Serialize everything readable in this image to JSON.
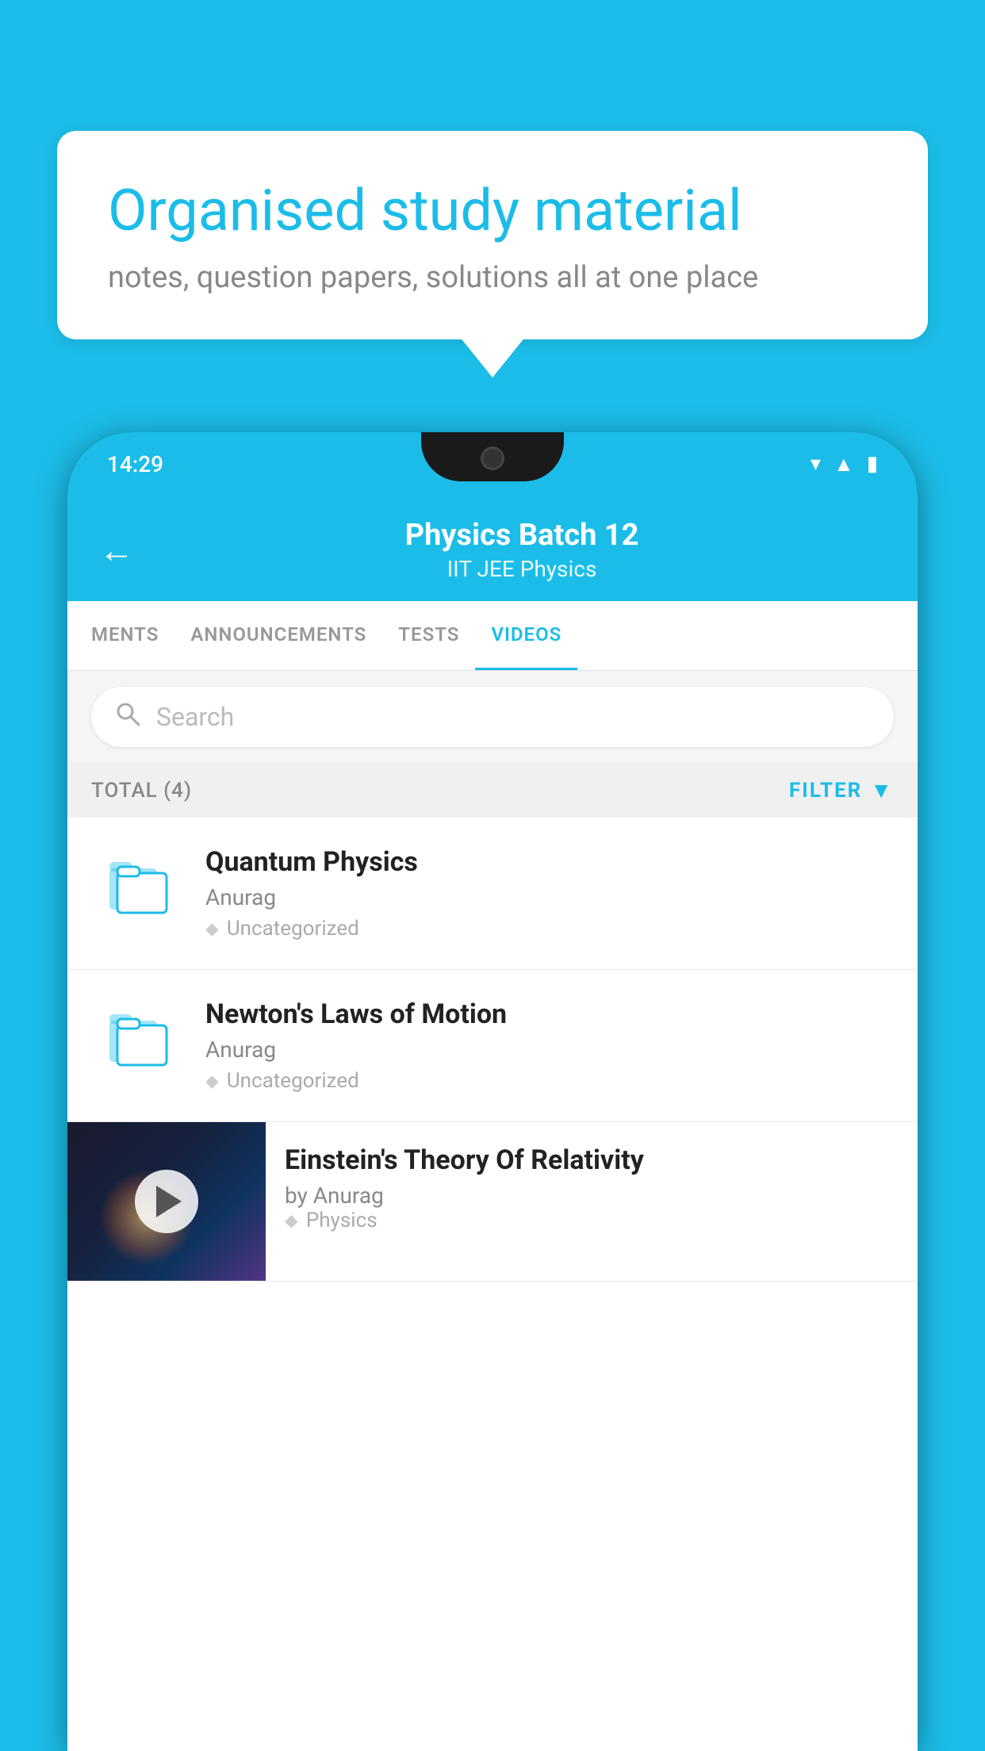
{
  "background_color": "#1BBDE8",
  "speech_bubble": {
    "title": "Organised study material",
    "subtitle": "notes, question papers, solutions all at one place"
  },
  "phone": {
    "status_bar": {
      "time": "14:29",
      "signal_icons": [
        "▼",
        "▲",
        "▮"
      ]
    },
    "header": {
      "back_label": "←",
      "title": "Physics Batch 12",
      "subtitle": "IIT JEE   Physics"
    },
    "tabs": [
      {
        "label": "MENTS",
        "active": false
      },
      {
        "label": "ANNOUNCEMENTS",
        "active": false
      },
      {
        "label": "TESTS",
        "active": false
      },
      {
        "label": "VIDEOS",
        "active": true
      }
    ],
    "search": {
      "placeholder": "Search"
    },
    "filter_bar": {
      "total_label": "TOTAL (4)",
      "filter_label": "FILTER"
    },
    "videos": [
      {
        "id": 1,
        "title": "Quantum Physics",
        "author": "Anurag",
        "tag": "Uncategorized",
        "has_thumbnail": false
      },
      {
        "id": 2,
        "title": "Newton's Laws of Motion",
        "author": "Anurag",
        "tag": "Uncategorized",
        "has_thumbnail": false
      },
      {
        "id": 3,
        "title": "Einstein's Theory Of Relativity",
        "author": "by Anurag",
        "tag": "Physics",
        "has_thumbnail": true
      }
    ]
  }
}
